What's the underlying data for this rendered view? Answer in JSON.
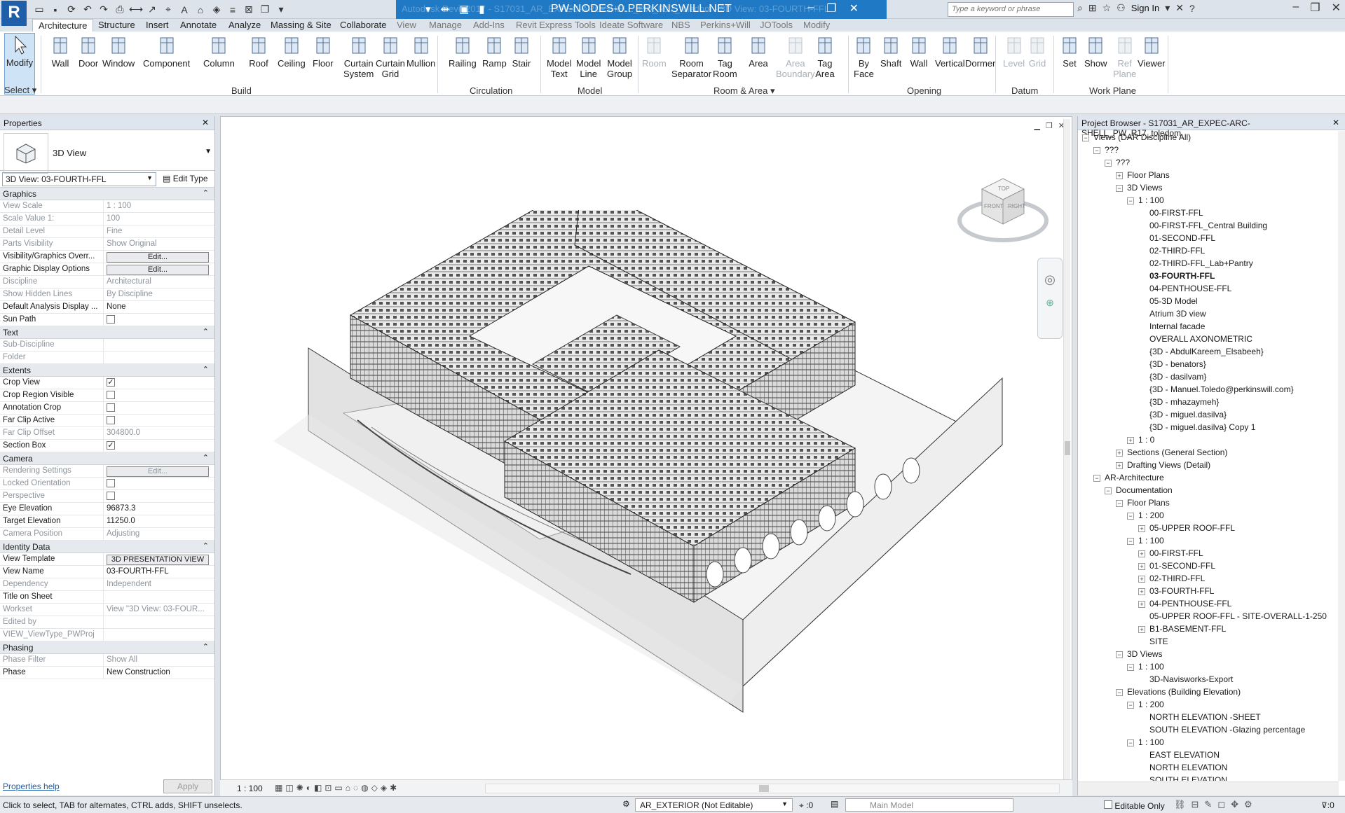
{
  "titlebar": {
    "title": "PW-NODES-0.PERKINSWILL.NET",
    "ghost_text": "Autodesk Revit 2017 - S17031_AR_EXPEC-ARC-SHELL_PW_R17_toledom - 3D View: 03-FOURTH-FFL",
    "search_placeholder": "Type a keyword or phrase",
    "sign_in": "Sign In",
    "app_logo": "R"
  },
  "tabs": [
    "Architecture",
    "Structure",
    "Insert",
    "Annotate",
    "Analyze",
    "Massing & Site",
    "Collaborate",
    "View",
    "Manage",
    "Add-Ins",
    "Revit Express Tools",
    "Ideate Software",
    "NBS",
    "Perkins+Will",
    "JOTools",
    "Modify"
  ],
  "ribbon": {
    "select": {
      "modify": "Modify",
      "select_label": "Select"
    },
    "build": {
      "label": "Build",
      "items": [
        "Wall",
        "Door",
        "Window",
        "Component",
        "Column",
        "Roof",
        "Ceiling",
        "Floor",
        "Curtain\nSystem",
        "Curtain\nGrid",
        "Mullion"
      ]
    },
    "circulation": {
      "label": "Circulation",
      "items": [
        "Railing",
        "Ramp",
        "Stair"
      ]
    },
    "model": {
      "label": "Model",
      "items": [
        "Model\nText",
        "Model\nLine",
        "Model\nGroup"
      ]
    },
    "room_area": {
      "label": "Room & Area",
      "items": [
        "Room",
        "Room\nSeparator",
        "Tag\nRoom",
        "Area",
        "Area\nBoundary",
        "Tag\nArea"
      ]
    },
    "opening": {
      "label": "Opening",
      "items": [
        "By\nFace",
        "Shaft",
        "Wall",
        "Vertical",
        "Dormer"
      ]
    },
    "datum": {
      "label": "Datum",
      "items": [
        "Level",
        "Grid"
      ]
    },
    "work_plane": {
      "label": "Work Plane",
      "items": [
        "Set",
        "Show",
        "Ref\nPlane",
        "Viewer"
      ]
    }
  },
  "properties": {
    "title": "Properties",
    "type_name": "3D View",
    "view_selector": "3D View: 03-FOURTH-FFL",
    "edit_type": "Edit Type",
    "sections": [
      {
        "name": "Graphics",
        "rows": [
          {
            "k": "View Scale",
            "v": "1 : 100",
            "ro": true
          },
          {
            "k": "Scale Value    1:",
            "v": "100",
            "ro": true
          },
          {
            "k": "Detail Level",
            "v": "Fine",
            "ro": true
          },
          {
            "k": "Parts Visibility",
            "v": "Show Original",
            "ro": true
          },
          {
            "k": "Visibility/Graphics Overr...",
            "v": "Edit...",
            "btn": true
          },
          {
            "k": "Graphic Display Options",
            "v": "Edit...",
            "btn": true
          },
          {
            "k": "Discipline",
            "v": "Architectural",
            "ro": true
          },
          {
            "k": "Show Hidden Lines",
            "v": "By Discipline",
            "ro": true
          },
          {
            "k": "Default Analysis Display ...",
            "v": "None"
          },
          {
            "k": "Sun Path",
            "v": "",
            "chk": false
          }
        ]
      },
      {
        "name": "Text",
        "rows": [
          {
            "k": "Sub-Discipline",
            "v": "",
            "ro": true
          },
          {
            "k": "Folder",
            "v": "",
            "ro": true
          }
        ]
      },
      {
        "name": "Extents",
        "rows": [
          {
            "k": "Crop View",
            "v": "",
            "chk": true
          },
          {
            "k": "Crop Region Visible",
            "v": "",
            "chk": false
          },
          {
            "k": "Annotation Crop",
            "v": "",
            "chk": false
          },
          {
            "k": "Far Clip Active",
            "v": "",
            "chk": false
          },
          {
            "k": "Far Clip Offset",
            "v": "304800.0",
            "ro": true
          },
          {
            "k": "Section Box",
            "v": "",
            "chk": true
          }
        ]
      },
      {
        "name": "Camera",
        "rows": [
          {
            "k": "Rendering Settings",
            "v": "Edit...",
            "btn": true,
            "ro": true
          },
          {
            "k": "Locked Orientation",
            "v": "",
            "chk": false,
            "ro": true
          },
          {
            "k": "Perspective",
            "v": "",
            "chk": false,
            "ro": true
          },
          {
            "k": "Eye Elevation",
            "v": "96873.3"
          },
          {
            "k": "Target Elevation",
            "v": "11250.0"
          },
          {
            "k": "Camera Position",
            "v": "Adjusting",
            "ro": true
          }
        ]
      },
      {
        "name": "Identity Data",
        "rows": [
          {
            "k": "View Template",
            "v": "3D PRESENTATION VIEW",
            "btn": true
          },
          {
            "k": "View Name",
            "v": "03-FOURTH-FFL"
          },
          {
            "k": "Dependency",
            "v": "Independent",
            "ro": true
          },
          {
            "k": "Title on Sheet",
            "v": ""
          },
          {
            "k": "Workset",
            "v": "View \"3D View: 03-FOUR...",
            "ro": true
          },
          {
            "k": "Edited by",
            "v": "",
            "ro": true
          },
          {
            "k": "VIEW_ViewType_PWProj",
            "v": "",
            "ro": true
          }
        ]
      },
      {
        "name": "Phasing",
        "rows": [
          {
            "k": "Phase Filter",
            "v": "Show All",
            "ro": true
          },
          {
            "k": "Phase",
            "v": "New Construction"
          }
        ]
      }
    ],
    "help": "Properties help",
    "apply": "Apply"
  },
  "viewport": {
    "scale": "1 : 100",
    "cube_labels": [
      "TOP",
      "FRONT",
      "RIGHT"
    ]
  },
  "browser": {
    "title": "Project Browser - S17031_AR_EXPEC-ARC-SHELL_PW_R17_toledom",
    "items": [
      {
        "t": "Views (DAR Discipline All)",
        "l": 0,
        "g": "−"
      },
      {
        "t": "???",
        "l": 1,
        "g": "−"
      },
      {
        "t": "???",
        "l": 2,
        "g": "−"
      },
      {
        "t": "Floor Plans",
        "l": 3,
        "g": "+"
      },
      {
        "t": "3D Views",
        "l": 3,
        "g": "−"
      },
      {
        "t": "1 : 100",
        "l": 4,
        "g": "−"
      },
      {
        "t": "00-FIRST-FFL",
        "l": 5
      },
      {
        "t": "00-FIRST-FFL_Central Building",
        "l": 5
      },
      {
        "t": "01-SECOND-FFL",
        "l": 5
      },
      {
        "t": "02-THIRD-FFL",
        "l": 5
      },
      {
        "t": "02-THIRD-FFL_Lab+Pantry",
        "l": 5
      },
      {
        "t": "03-FOURTH-FFL",
        "l": 5,
        "b": true
      },
      {
        "t": "04-PENTHOUSE-FFL",
        "l": 5
      },
      {
        "t": "05-3D Model",
        "l": 5
      },
      {
        "t": "Atrium 3D view",
        "l": 5
      },
      {
        "t": "Internal facade",
        "l": 5
      },
      {
        "t": "OVERALL AXONOMETRIC",
        "l": 5
      },
      {
        "t": "{3D - AbdulKareem_Elsabeeh}",
        "l": 5
      },
      {
        "t": "{3D - benators}",
        "l": 5
      },
      {
        "t": "{3D - dasilvam}",
        "l": 5
      },
      {
        "t": "{3D - Manuel.Toledo@perkinswill.com}",
        "l": 5
      },
      {
        "t": "{3D - mhazaymeh}",
        "l": 5
      },
      {
        "t": "{3D - miguel.dasilva}",
        "l": 5
      },
      {
        "t": "{3D - miguel.dasilva} Copy 1",
        "l": 5
      },
      {
        "t": "1 : 0",
        "l": 4,
        "g": "+"
      },
      {
        "t": "Sections (General Section)",
        "l": 3,
        "g": "+"
      },
      {
        "t": "Drafting Views (Detail)",
        "l": 3,
        "g": "+"
      },
      {
        "t": "AR-Architecture",
        "l": 1,
        "g": "−"
      },
      {
        "t": "Documentation",
        "l": 2,
        "g": "−"
      },
      {
        "t": "Floor Plans",
        "l": 3,
        "g": "−"
      },
      {
        "t": "1 : 200",
        "l": 4,
        "g": "−"
      },
      {
        "t": "05-UPPER ROOF-FFL",
        "l": 5,
        "g": "+"
      },
      {
        "t": "1 : 100",
        "l": 4,
        "g": "−"
      },
      {
        "t": "00-FIRST-FFL",
        "l": 5,
        "g": "+"
      },
      {
        "t": "01-SECOND-FFL",
        "l": 5,
        "g": "+"
      },
      {
        "t": "02-THIRD-FFL",
        "l": 5,
        "g": "+"
      },
      {
        "t": "03-FOURTH-FFL",
        "l": 5,
        "g": "+"
      },
      {
        "t": "04-PENTHOUSE-FFL",
        "l": 5,
        "g": "+"
      },
      {
        "t": "05-UPPER ROOF-FFL - SITE-OVERALL-1-250",
        "l": 5
      },
      {
        "t": "B1-BASEMENT-FFL",
        "l": 5,
        "g": "+"
      },
      {
        "t": "SITE",
        "l": 5
      },
      {
        "t": "3D Views",
        "l": 3,
        "g": "−"
      },
      {
        "t": "1 : 100",
        "l": 4,
        "g": "−"
      },
      {
        "t": "3D-Navisworks-Export",
        "l": 5
      },
      {
        "t": "Elevations (Building Elevation)",
        "l": 3,
        "g": "−"
      },
      {
        "t": "1 : 200",
        "l": 4,
        "g": "−"
      },
      {
        "t": "NORTH ELEVATION -SHEET",
        "l": 5
      },
      {
        "t": "SOUTH ELEVATION -Glazing percentage",
        "l": 5
      },
      {
        "t": "1 : 100",
        "l": 4,
        "g": "−"
      },
      {
        "t": "EAST ELEVATION",
        "l": 5
      },
      {
        "t": "NORTH ELEVATION",
        "l": 5
      },
      {
        "t": "SOUTH ELEVATION",
        "l": 5
      }
    ]
  },
  "status": {
    "text": "Click to select, TAB for alternates, CTRL adds, SHIFT unselects.",
    "workset": "AR_EXTERIOR (Not Editable)",
    "count": ":0",
    "model": "Main Model",
    "editable_only": "Editable Only",
    "filter_count": ":0"
  },
  "colors": {
    "accent": "#1f79c4",
    "brand": "#1f5ea8"
  }
}
